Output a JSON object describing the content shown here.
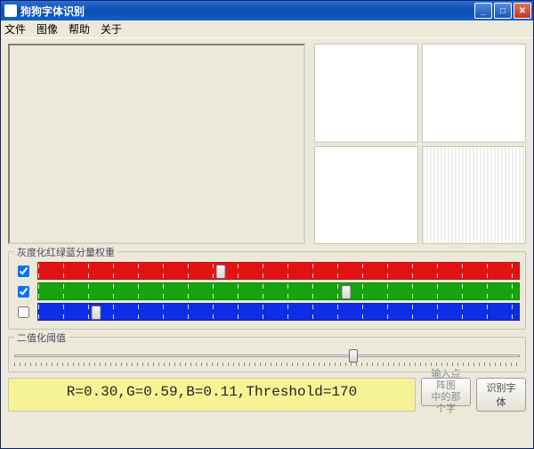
{
  "window": {
    "title": "狗狗字体识别"
  },
  "menu": {
    "file": "文件",
    "image": "图像",
    "help": "帮助",
    "about": "关于"
  },
  "group_rgb": {
    "title": "灰度化红绿蓝分量权重",
    "r_checked": true,
    "g_checked": true,
    "b_checked": false,
    "r_pos_pct": 38,
    "g_pos_pct": 64,
    "b_pos_pct": 12
  },
  "group_threshold": {
    "title": "二值化阈值",
    "pos_pct": 67
  },
  "readout": {
    "text": "R=0.30,G=0.59,B=0.11,Threshold=170"
  },
  "buttons": {
    "input_hint": "输入点阵图\n中的那个字",
    "recognize": "识别字体"
  },
  "winbtn": {
    "min": "_",
    "max": "□",
    "close": "✕"
  }
}
